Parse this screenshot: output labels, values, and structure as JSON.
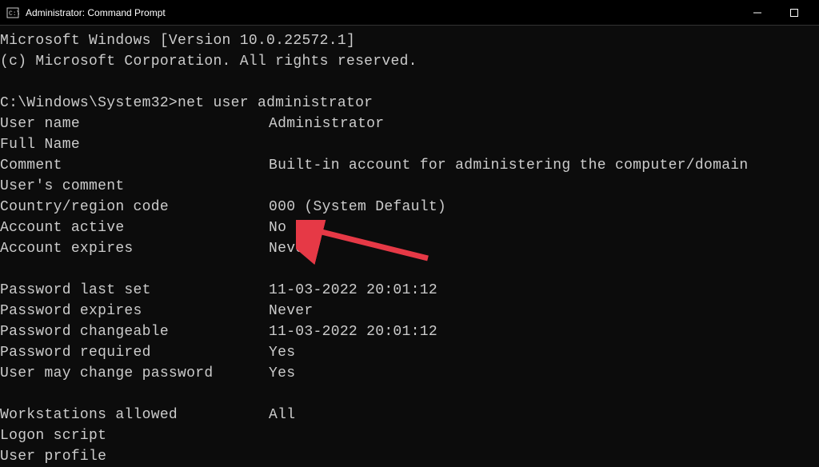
{
  "window": {
    "title": "Administrator: Command Prompt"
  },
  "terminal": {
    "header_line1": "Microsoft Windows [Version 10.0.22572.1]",
    "header_line2": "(c) Microsoft Corporation. All rights reserved.",
    "prompt": "C:\\Windows\\System32>",
    "command": "net user administrator",
    "fields": {
      "user_name_label": "User name",
      "user_name_value": "Administrator",
      "full_name_label": "Full Name",
      "full_name_value": "",
      "comment_label": "Comment",
      "comment_value": "Built-in account for administering the computer/domain",
      "users_comment_label": "User's comment",
      "users_comment_value": "",
      "country_label": "Country/region code",
      "country_value": "000 (System Default)",
      "account_active_label": "Account active",
      "account_active_value": "No",
      "account_expires_label": "Account expires",
      "account_expires_value": "Never",
      "pwd_last_set_label": "Password last set",
      "pwd_last_set_value": "11-03-2022 20:01:12",
      "pwd_expires_label": "Password expires",
      "pwd_expires_value": "Never",
      "pwd_changeable_label": "Password changeable",
      "pwd_changeable_value": "11-03-2022 20:01:12",
      "pwd_required_label": "Password required",
      "pwd_required_value": "Yes",
      "user_may_change_label": "User may change password",
      "user_may_change_value": "Yes",
      "workstations_label": "Workstations allowed",
      "workstations_value": "All",
      "logon_script_label": "Logon script",
      "logon_script_value": "",
      "user_profile_label": "User profile",
      "user_profile_value": ""
    }
  }
}
